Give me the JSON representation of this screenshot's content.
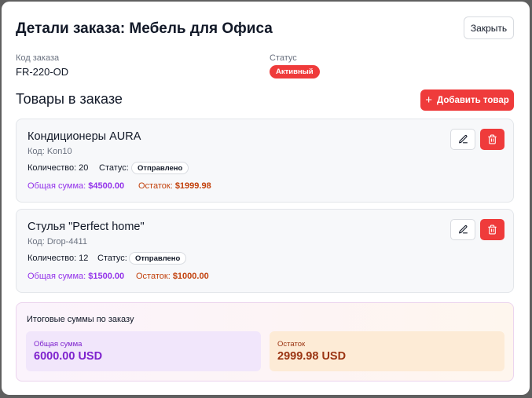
{
  "header": {
    "title": "Детали заказа: Мебель для Офиса",
    "close_label": "Закрыть"
  },
  "order": {
    "code_label": "Код заказа",
    "code_value": "FR-220-OD",
    "status_label": "Статус",
    "status_value": "Активный"
  },
  "items_section": {
    "title": "Товары в заказе",
    "add_label": "Добавить товар",
    "items": [
      {
        "name": "Кондиционеры AURA",
        "code": "Код: Kon10",
        "quantity": "Количество: 20",
        "status_label": "Статус:",
        "status": "Отправлено",
        "total_label": "Общая сумма:",
        "total_value": "$4500.00",
        "rest_label": "Остаток:",
        "rest_value": "$1999.98"
      },
      {
        "name": "Стулья \"Perfect home\"",
        "code": "Код: Drop-4411",
        "quantity": "Количество: 12",
        "status_label": "Статус:",
        "status": "Отправлено",
        "total_label": "Общая сумма:",
        "total_value": "$1500.00",
        "rest_label": "Остаток:",
        "rest_value": "$1000.00"
      }
    ]
  },
  "summary": {
    "title": "Итоговые суммы по заказу",
    "total_label": "Общая сумма",
    "total_value": "6000.00 USD",
    "rest_label": "Остаток",
    "rest_value": "2999.98 USD"
  },
  "colors": {
    "accent": "#ef3b3b",
    "total_purple": "#9333ea",
    "rest_orange": "#c2410c",
    "overlay": "#5f5f5f"
  },
  "icons": [
    "plus-icon",
    "edit-icon",
    "trash-icon"
  ]
}
